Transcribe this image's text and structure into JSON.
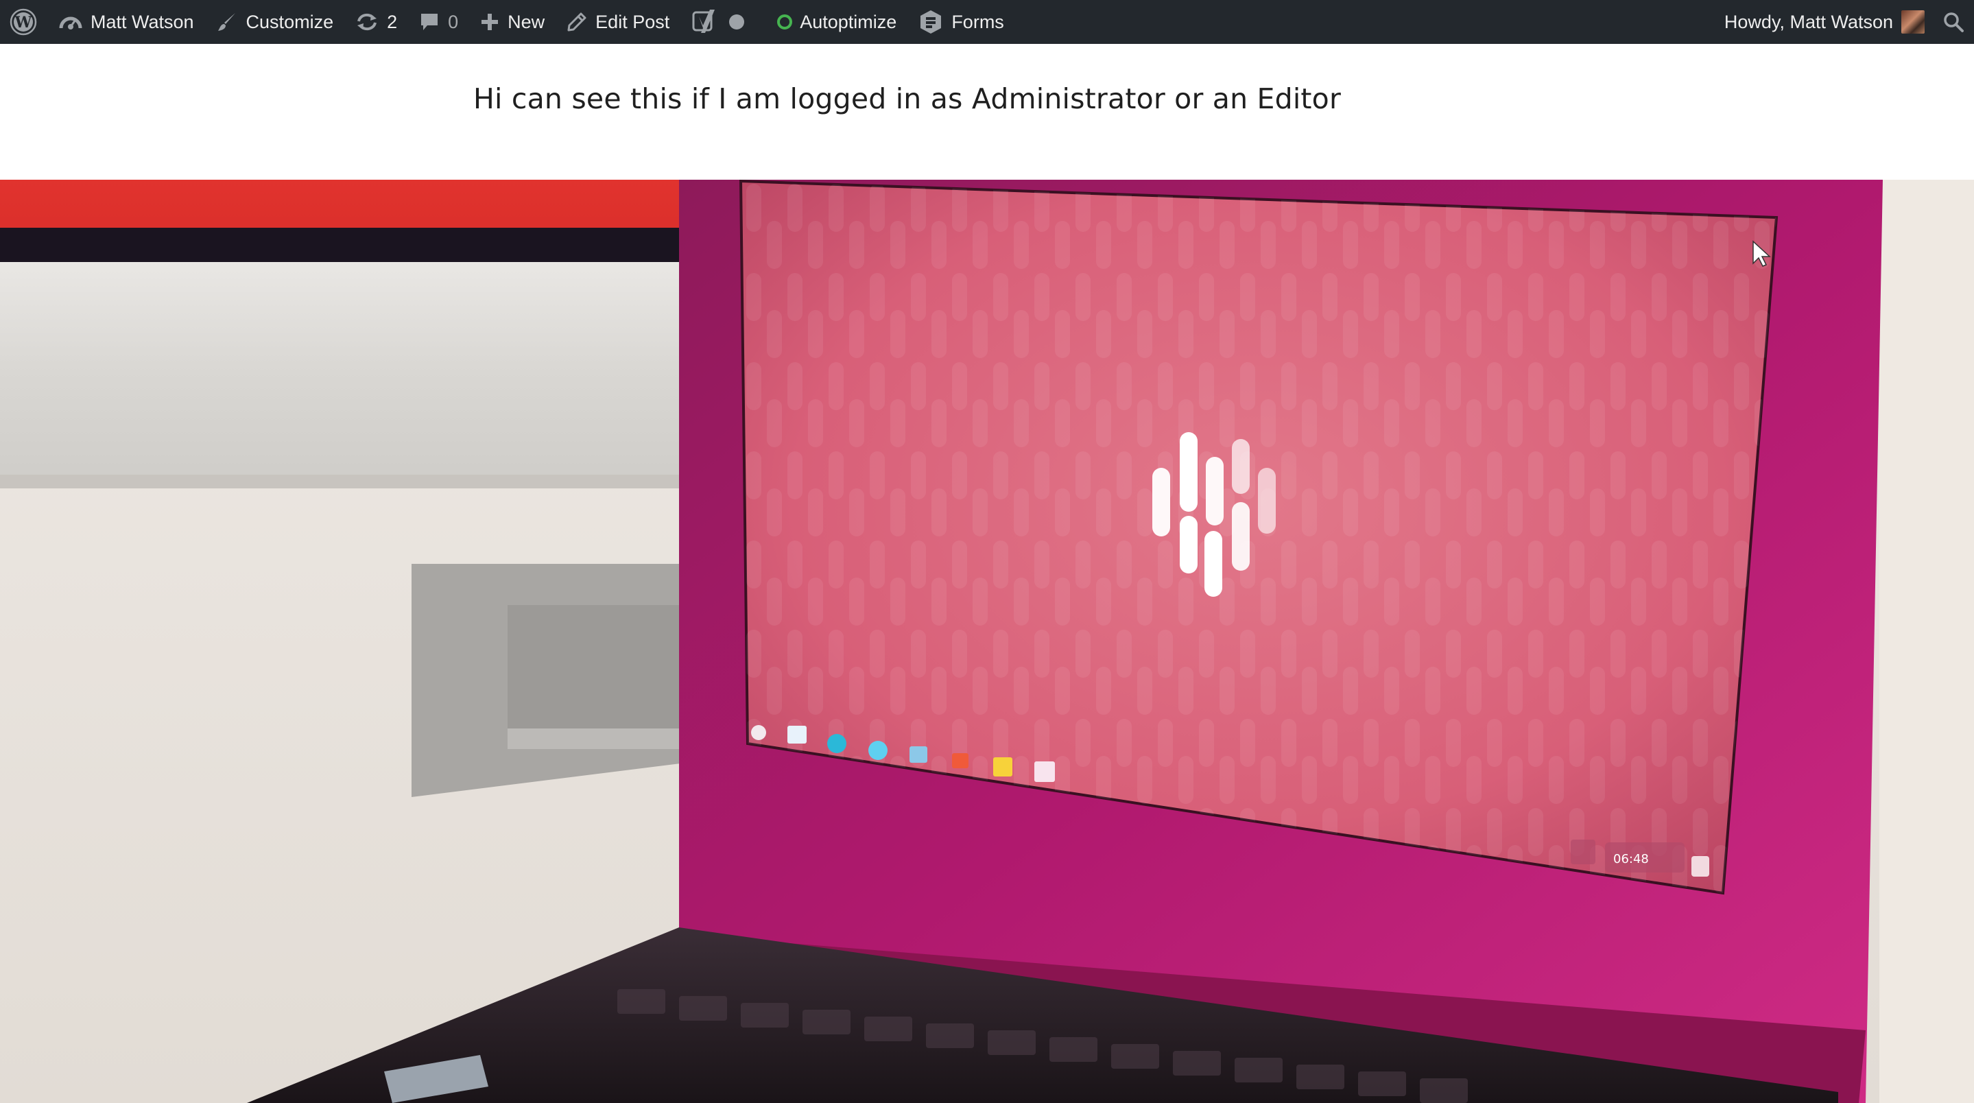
{
  "admin_bar": {
    "site_name": "Matt Watson",
    "customize_label": "Customize",
    "updates_count": "2",
    "comments_count": "0",
    "new_label": "New",
    "edit_post_label": "Edit Post",
    "autoptimize_label": "Autoptimize",
    "forms_label": "Forms",
    "greeting": "Howdy, Matt Watson",
    "icons": [
      "wordpress-logo-icon",
      "dashboard-icon",
      "brush-icon",
      "updates-icon",
      "comment-icon",
      "plus-icon",
      "pencil-icon",
      "yoast-icon",
      "status-dot-icon",
      "autoptimize-status-icon",
      "forms-icon",
      "avatar",
      "search-icon"
    ],
    "colors": {
      "background": "#23282d",
      "text": "#eeeeee",
      "autoptimize_ok": "#46b450"
    }
  },
  "content": {
    "notice_text": "Hi can see this if I am logged in as Administrator or an Editor"
  },
  "hero_image": {
    "screen_clock": "06:48"
  }
}
